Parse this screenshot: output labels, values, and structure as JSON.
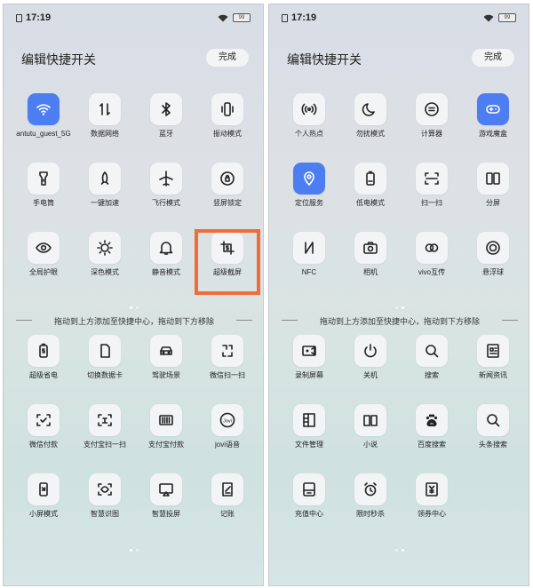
{
  "colors": {
    "accent": "#4c7ef2",
    "highlight": "#f26b3a"
  },
  "left": {
    "status": {
      "time": "17:19",
      "battery": "99"
    },
    "title": "编辑快捷开关",
    "done": "完成",
    "active_tiles": [
      {
        "label": "antutu_guest_5G",
        "icon": "wifi-icon",
        "on": true
      },
      {
        "label": "数据网络",
        "icon": "data-arrows-icon"
      },
      {
        "label": "蓝牙",
        "icon": "bluetooth-icon"
      },
      {
        "label": "振动模式",
        "icon": "vibrate-icon"
      },
      {
        "label": "手电筒",
        "icon": "flashlight-icon"
      },
      {
        "label": "一键加速",
        "icon": "rocket-icon"
      },
      {
        "label": "飞行模式",
        "icon": "airplane-icon"
      },
      {
        "label": "竖屏锁定",
        "icon": "rotation-lock-icon"
      },
      {
        "label": "全局护眼",
        "icon": "eye-icon"
      },
      {
        "label": "深色模式",
        "icon": "dark-mode-icon"
      },
      {
        "label": "静音模式",
        "icon": "bell-icon"
      },
      {
        "label": "超级截屏",
        "icon": "screenshot-icon"
      }
    ],
    "hint": "拖动到上方添加至快捷中心，拖动到下方移除",
    "available_tiles": [
      {
        "label": "超级省电",
        "icon": "battery-save-icon"
      },
      {
        "label": "切换数据卡",
        "icon": "sim-card-icon"
      },
      {
        "label": "驾驶场景",
        "icon": "car-icon"
      },
      {
        "label": "微信扫一扫",
        "icon": "wechat-scan-icon"
      },
      {
        "label": "微信付款",
        "icon": "wechat-pay-icon"
      },
      {
        "label": "支付宝扫一扫",
        "icon": "alipay-scan-icon"
      },
      {
        "label": "支付宝付款",
        "icon": "barcode-icon"
      },
      {
        "label": "jovi语音",
        "icon": "jovi-icon"
      },
      {
        "label": "小屏模式",
        "icon": "small-screen-icon"
      },
      {
        "label": "智慧识图",
        "icon": "image-recognition-icon"
      },
      {
        "label": "智慧投屏",
        "icon": "screen-cast-icon"
      },
      {
        "label": "记账",
        "icon": "notebook-icon"
      }
    ]
  },
  "right": {
    "status": {
      "time": "17:19",
      "battery": "99"
    },
    "title": "编辑快捷开关",
    "done": "完成",
    "active_tiles": [
      {
        "label": "个人热点",
        "icon": "hotspot-icon"
      },
      {
        "label": "勿扰模式",
        "icon": "moon-icon"
      },
      {
        "label": "计算器",
        "icon": "calculator-icon"
      },
      {
        "label": "游戏魔盒",
        "icon": "gamepad-icon",
        "on": true
      },
      {
        "label": "定位服务",
        "icon": "location-icon",
        "on": true
      },
      {
        "label": "低电模式",
        "icon": "low-battery-icon"
      },
      {
        "label": "扫一扫",
        "icon": "scan-icon"
      },
      {
        "label": "分屏",
        "icon": "split-screen-icon"
      },
      {
        "label": "NFC",
        "icon": "nfc-icon"
      },
      {
        "label": "相机",
        "icon": "camera-icon"
      },
      {
        "label": "vivo互传",
        "icon": "share-icon"
      },
      {
        "label": "悬浮球",
        "icon": "float-ball-icon"
      }
    ],
    "hint": "拖动到上方添加至快捷中心，拖动到下方移除",
    "available_tiles": [
      {
        "label": "录制屏幕",
        "icon": "screen-record-icon"
      },
      {
        "label": "关机",
        "icon": "power-icon"
      },
      {
        "label": "搜索",
        "icon": "search-icon"
      },
      {
        "label": "新闻资讯",
        "icon": "news-icon"
      },
      {
        "label": "文件管理",
        "icon": "file-manager-icon"
      },
      {
        "label": "小说",
        "icon": "book-icon"
      },
      {
        "label": "百度搜索",
        "icon": "baidu-icon"
      },
      {
        "label": "头条搜索",
        "icon": "search-icon"
      },
      {
        "label": "充值中心",
        "icon": "recharge-icon"
      },
      {
        "label": "限时秒杀",
        "icon": "alarm-icon"
      },
      {
        "label": "领券中心",
        "icon": "coupon-icon"
      }
    ]
  }
}
